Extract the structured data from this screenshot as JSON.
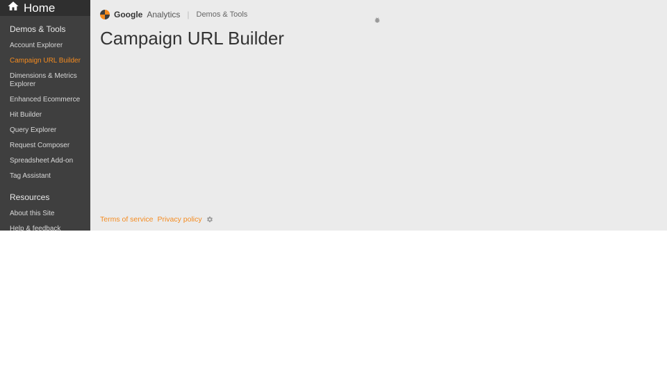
{
  "sidebar": {
    "home_label": "Home",
    "sections": [
      {
        "title": "Demos & Tools",
        "items": [
          {
            "label": "Account Explorer",
            "active": false
          },
          {
            "label": "Campaign URL Builder",
            "active": true
          },
          {
            "label": "Dimensions & Metrics Explorer",
            "active": false
          },
          {
            "label": "Enhanced Ecommerce",
            "active": false
          },
          {
            "label": "Hit Builder",
            "active": false
          },
          {
            "label": "Query Explorer",
            "active": false
          },
          {
            "label": "Request Composer",
            "active": false
          },
          {
            "label": "Spreadsheet Add-on",
            "active": false
          },
          {
            "label": "Tag Assistant",
            "active": false
          }
        ]
      },
      {
        "title": "Resources",
        "items": [
          {
            "label": "About this Site",
            "active": false
          },
          {
            "label": "Help & feedback",
            "active": false
          }
        ]
      }
    ]
  },
  "brand": {
    "google": "Google",
    "analytics": "Analytics",
    "subtitle": "Demos & Tools"
  },
  "page": {
    "title": "Campaign URL Builder"
  },
  "footer": {
    "terms": "Terms of service",
    "privacy": "Privacy policy"
  }
}
